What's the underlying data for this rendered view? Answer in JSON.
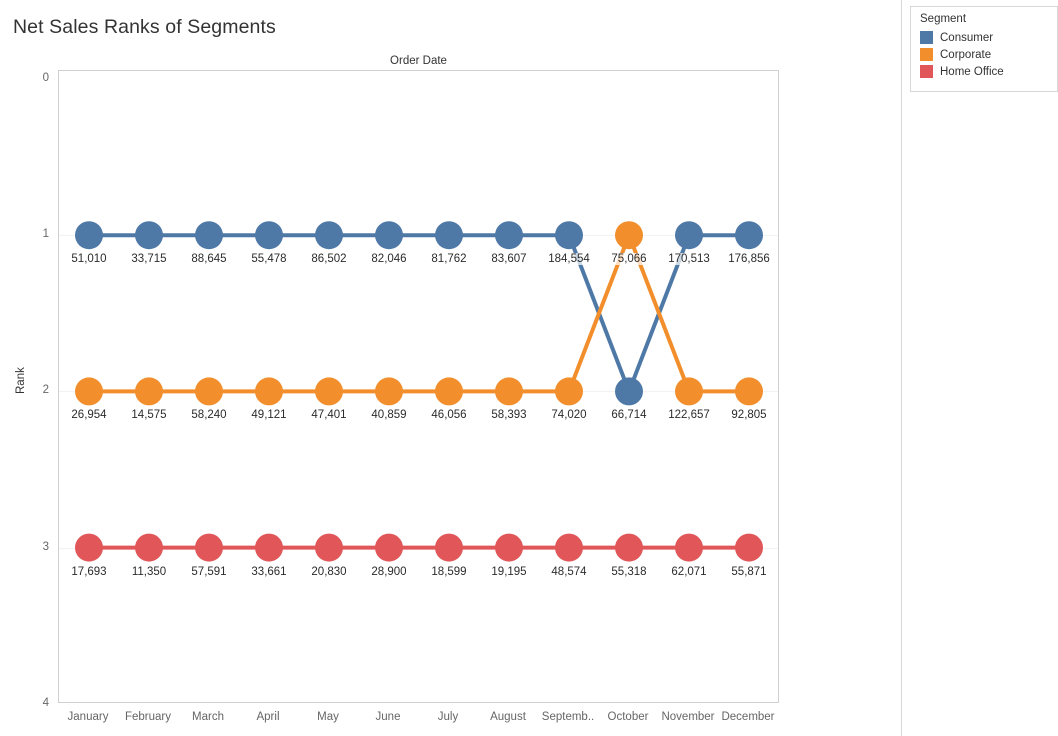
{
  "header": {
    "title": "Net Sales Ranks of Segments"
  },
  "legend": {
    "title": "Segment",
    "items": [
      {
        "label": "Consumer",
        "color": "#4E79A7",
        "swatch_icon": "color-swatch-icon"
      },
      {
        "label": "Corporate",
        "color": "#F28E2B",
        "swatch_icon": "color-swatch-icon"
      },
      {
        "label": "Home Office",
        "color": "#E15759",
        "swatch_icon": "color-swatch-icon"
      }
    ]
  },
  "axes": {
    "column_field_label": "Order Date",
    "y_title": "Rank",
    "y_ticks": [
      "0",
      "1",
      "2",
      "3",
      "4"
    ],
    "x_ticks": [
      "January",
      "February",
      "March",
      "April",
      "May",
      "June",
      "July",
      "August",
      "Septemb..",
      "October",
      "November",
      "December"
    ]
  },
  "chart_data": {
    "type": "line",
    "title": "Net Sales Ranks of Segments",
    "subtitle": "",
    "xlabel": "Order Date",
    "ylabel": "Rank",
    "grid": true,
    "legend_position": "right",
    "legend_title": "Segment",
    "inverted_y": true,
    "ylim": [
      0,
      4
    ],
    "yticks": [
      0,
      1,
      2,
      3,
      4
    ],
    "x": [
      "January",
      "February",
      "March",
      "April",
      "May",
      "June",
      "July",
      "August",
      "September",
      "October",
      "November",
      "December"
    ],
    "x_tick_labels": [
      "January",
      "February",
      "March",
      "April",
      "May",
      "June",
      "July",
      "August",
      "Septemb..",
      "October",
      "November",
      "December"
    ],
    "series": [
      {
        "name": "Consumer",
        "color": "#4E79A7",
        "values": [
          1,
          1,
          1,
          1,
          1,
          1,
          1,
          1,
          1,
          2,
          1,
          1
        ],
        "point_labels": [
          "51,010",
          "33,715",
          "88,645",
          "55,478",
          "86,502",
          "82,046",
          "81,762",
          "83,607",
          "184,554",
          "66,714",
          "170,513",
          "176,856"
        ],
        "point_values": [
          51010,
          33715,
          88645,
          55478,
          86502,
          82046,
          81762,
          83607,
          184554,
          66714,
          170513,
          176856
        ]
      },
      {
        "name": "Corporate",
        "color": "#F28E2B",
        "values": [
          2,
          2,
          2,
          2,
          2,
          2,
          2,
          2,
          2,
          1,
          2,
          2
        ],
        "point_labels": [
          "26,954",
          "14,575",
          "58,240",
          "49,121",
          "47,401",
          "40,859",
          "46,056",
          "58,393",
          "74,020",
          "75,066",
          "122,657",
          "92,805"
        ],
        "point_values": [
          26954,
          14575,
          58240,
          49121,
          47401,
          40859,
          46056,
          58393,
          74020,
          75066,
          122657,
          92805
        ]
      },
      {
        "name": "Home Office",
        "color": "#E15759",
        "values": [
          3,
          3,
          3,
          3,
          3,
          3,
          3,
          3,
          3,
          3,
          3,
          3
        ],
        "point_labels": [
          "17,693",
          "11,350",
          "57,591",
          "33,661",
          "20,830",
          "28,900",
          "18,599",
          "19,195",
          "48,574",
          "55,318",
          "62,071",
          "55,871"
        ],
        "point_values": [
          17693,
          11350,
          57591,
          33661,
          20830,
          28900,
          18599,
          19195,
          48574,
          55318,
          62071,
          55871
        ]
      }
    ]
  }
}
